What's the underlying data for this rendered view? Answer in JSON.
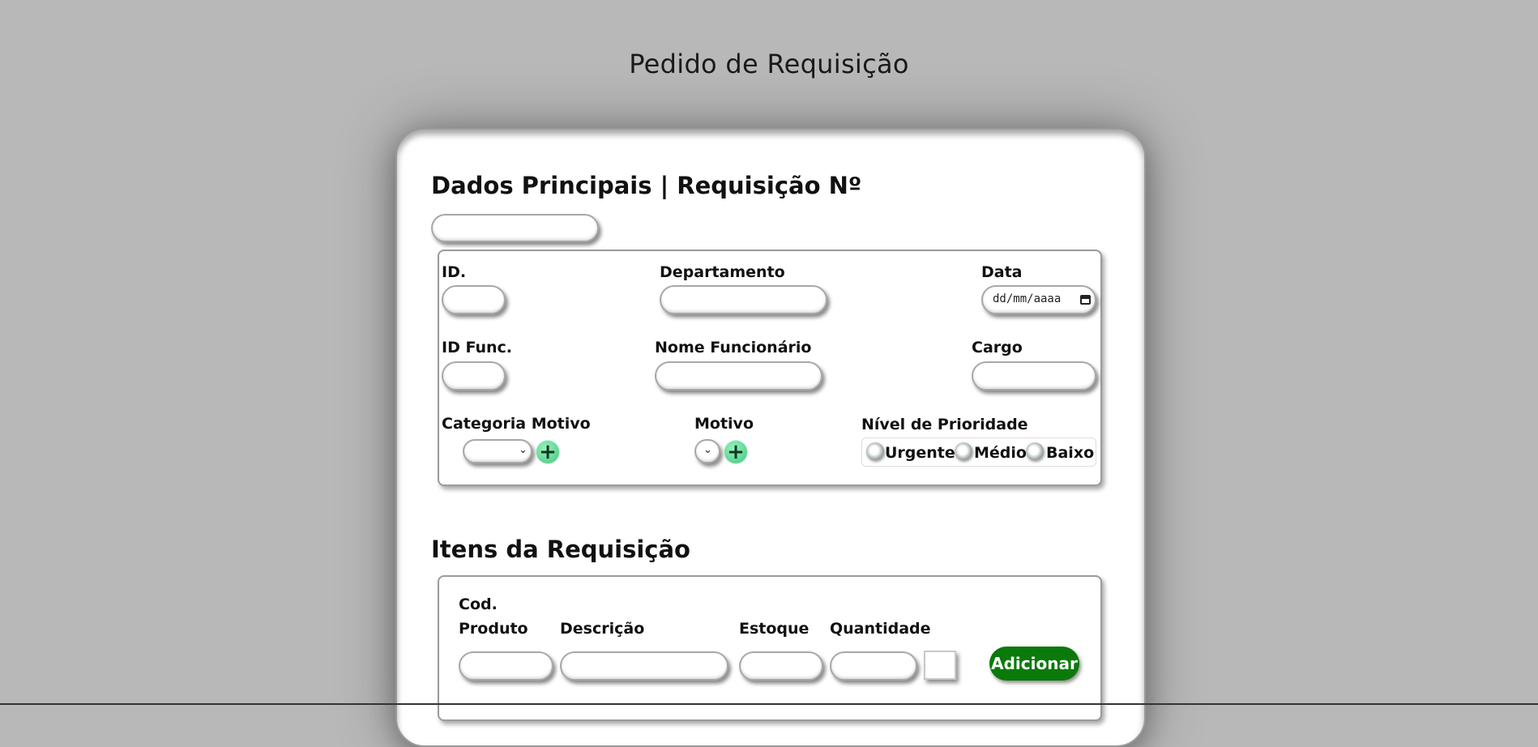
{
  "page": {
    "title": "Pedido de Requisição"
  },
  "main": {
    "heading": "Dados Principais | Requisição Nº",
    "labels": {
      "id": "ID.",
      "departamento": "Departamento",
      "data": "Data",
      "id_func": "ID Func.",
      "nome_funcionario": "Nome Funcionário",
      "cargo": "Cargo",
      "categoria_motivo": "Categoria Motivo",
      "motivo": "Motivo",
      "nivel_prioridade": "Nível de Prioridade"
    },
    "date_placeholder": "dd/mm/aaaa",
    "priority_options": [
      "Urgente",
      "Médio",
      "Baixo"
    ]
  },
  "items": {
    "heading": "Itens da Requisição",
    "labels": {
      "cod_line1": "Cod.",
      "cod_line2": "Produto",
      "descricao": "Descrição",
      "estoque": "Estoque",
      "quantidade": "Quantidade"
    },
    "add_button": "Adicionar"
  },
  "colors": {
    "background": "#b8b8b8",
    "accent_green": "#0a7a0a",
    "plus_green": "#3ec77d"
  },
  "icons": {
    "plus": "plus-icon",
    "calendar": "calendar-icon",
    "select_arrow": "chevron-down-icon"
  }
}
